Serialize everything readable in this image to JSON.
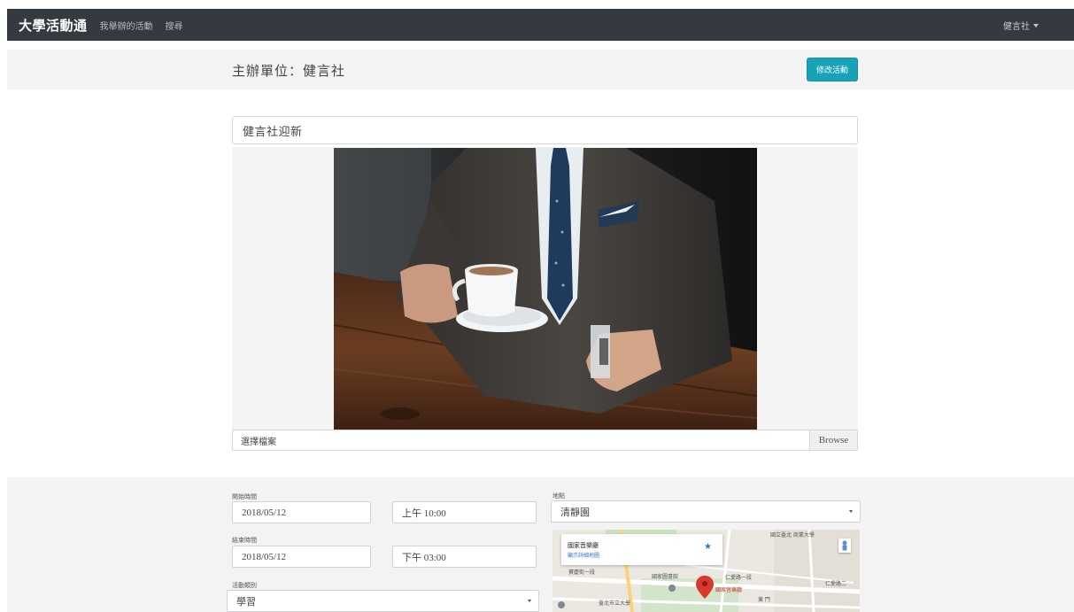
{
  "navbar": {
    "brand": "大學活動通",
    "links": [
      "我舉辦的活動",
      "搜尋"
    ],
    "user": "健言社"
  },
  "header": {
    "org_title": "主辦單位：健言社",
    "edit_button": "修改活動"
  },
  "event": {
    "title": "健言社迎新",
    "file_placeholder": "選擇檔案",
    "browse_label": "Browse"
  },
  "form": {
    "start_label": "開始時間",
    "start_date": "2018/05/12",
    "start_time": "上午 10:00",
    "end_label": "結束時間",
    "end_date": "2018/05/12",
    "end_time": "下午 03:00",
    "category_label": "活動類別",
    "category_value": "學習",
    "location_label": "地點",
    "location_value": "清靜園"
  },
  "map": {
    "info_title": "國家音樂廳",
    "info_link": "顯示詳細地圖",
    "labels": {
      "university": "國立臺北 商業大學",
      "library": "國家圖書館",
      "concert_hall": "國家音樂廳",
      "school": "臺北市立大學",
      "gate": "東 門",
      "road1": "仁愛路一段",
      "road2": "仁愛路二",
      "road3": "寶慶街一段"
    }
  },
  "colors": {
    "navbar_bg": "#343a40",
    "accent": "#17a2b8",
    "band_bg": "#f3f3f3"
  }
}
